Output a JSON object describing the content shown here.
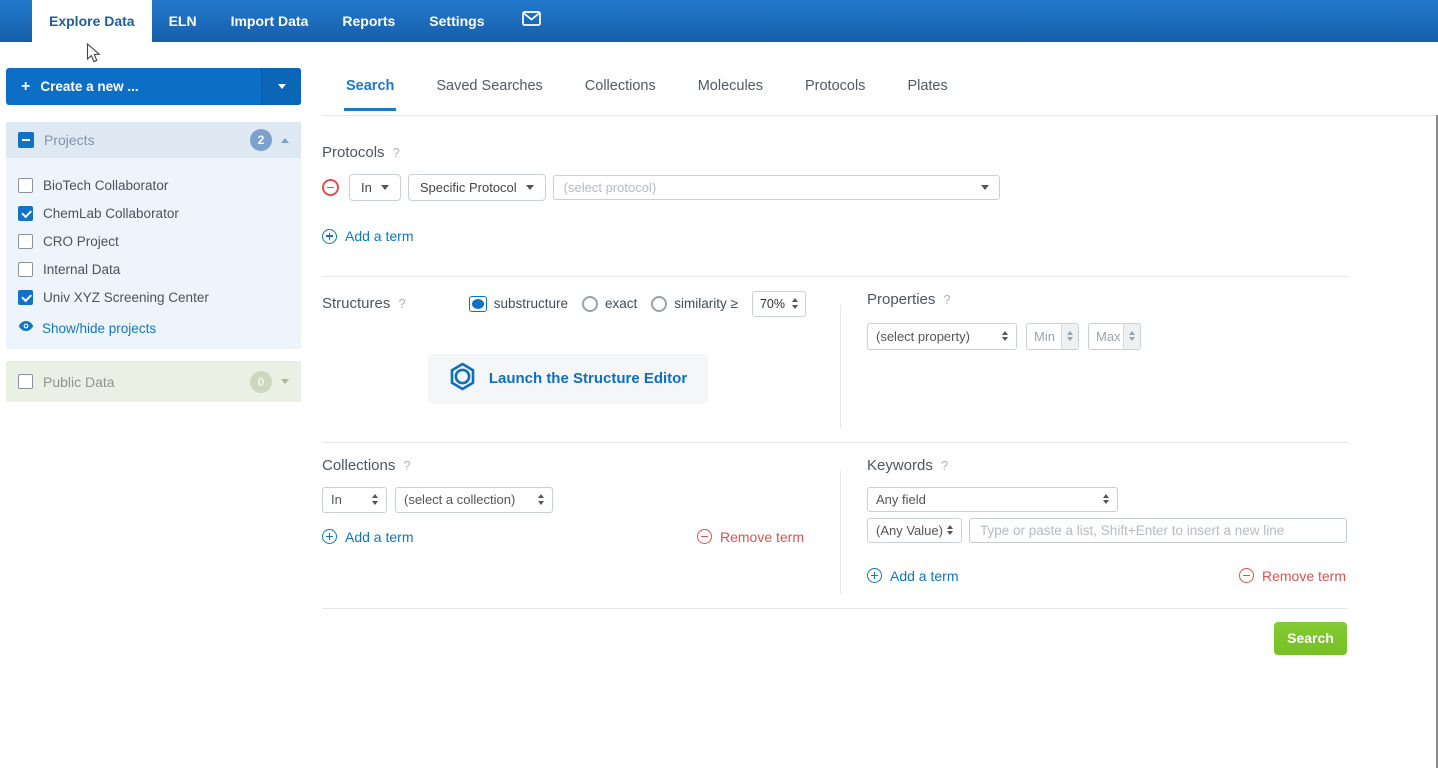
{
  "nav": {
    "tabs": [
      {
        "label": "Explore Data",
        "active": true
      },
      {
        "label": "ELN",
        "active": false
      },
      {
        "label": "Import Data",
        "active": false
      },
      {
        "label": "Reports",
        "active": false
      },
      {
        "label": "Settings",
        "active": false
      }
    ],
    "mail_icon": "envelope-icon"
  },
  "sidebar": {
    "create_button": {
      "label": "Create a new ...",
      "plus_icon": "plus-icon",
      "dropdown_icon": "chevron-down-icon"
    },
    "projects": {
      "title": "Projects",
      "count": "2",
      "checkbox_state": "indeterminate",
      "collapse_icon": "chevron-up-icon",
      "items": [
        {
          "label": "BioTech Collaborator",
          "checked": false
        },
        {
          "label": "ChemLab Collaborator",
          "checked": true
        },
        {
          "label": "CRO Project",
          "checked": false
        },
        {
          "label": "Internal Data",
          "checked": false
        },
        {
          "label": "Univ XYZ Screening Center",
          "checked": true
        }
      ],
      "show_hide_link": "Show/hide projects",
      "show_hide_icon": "eye-icon"
    },
    "public_data": {
      "title": "Public Data",
      "count": "0",
      "checked": false,
      "collapse_icon": "chevron-down-icon"
    }
  },
  "main": {
    "tabs": [
      {
        "label": "Search",
        "active": true
      },
      {
        "label": "Saved Searches",
        "active": false
      },
      {
        "label": "Collections",
        "active": false
      },
      {
        "label": "Molecules",
        "active": false
      },
      {
        "label": "Protocols",
        "active": false
      },
      {
        "label": "Plates",
        "active": false
      }
    ],
    "help_char": "?",
    "protocols": {
      "heading": "Protocols",
      "remove_icon": "minus-circle-icon",
      "in_select": "In",
      "type_select": "Specific Protocol",
      "protocol_placeholder": "(select protocol)",
      "add_term": "Add a term"
    },
    "structures": {
      "heading": "Structures",
      "radios": [
        {
          "label": "substructure",
          "selected": true
        },
        {
          "label": "exact",
          "selected": false
        },
        {
          "label": "similarity ≥",
          "selected": false
        }
      ],
      "similarity_value": "70%",
      "editor_button": "Launch the Structure Editor",
      "editor_icon": "benzene-ring-icon"
    },
    "properties": {
      "heading": "Properties",
      "select_placeholder": "(select property)",
      "min_placeholder": "Min",
      "max_placeholder": "Max"
    },
    "collections": {
      "heading": "Collections",
      "in_select": "In",
      "select_placeholder": "(select a collection)",
      "add_term": "Add a term",
      "remove_term": "Remove term"
    },
    "keywords": {
      "heading": "Keywords",
      "field_select": "Any field",
      "value_select": "(Any Value)",
      "input_value": "",
      "input_placeholder": "Type or paste a list, Shift+Enter to insert a new line",
      "add_term": "Add a term",
      "remove_term": "Remove term"
    },
    "search_button": "Search"
  }
}
